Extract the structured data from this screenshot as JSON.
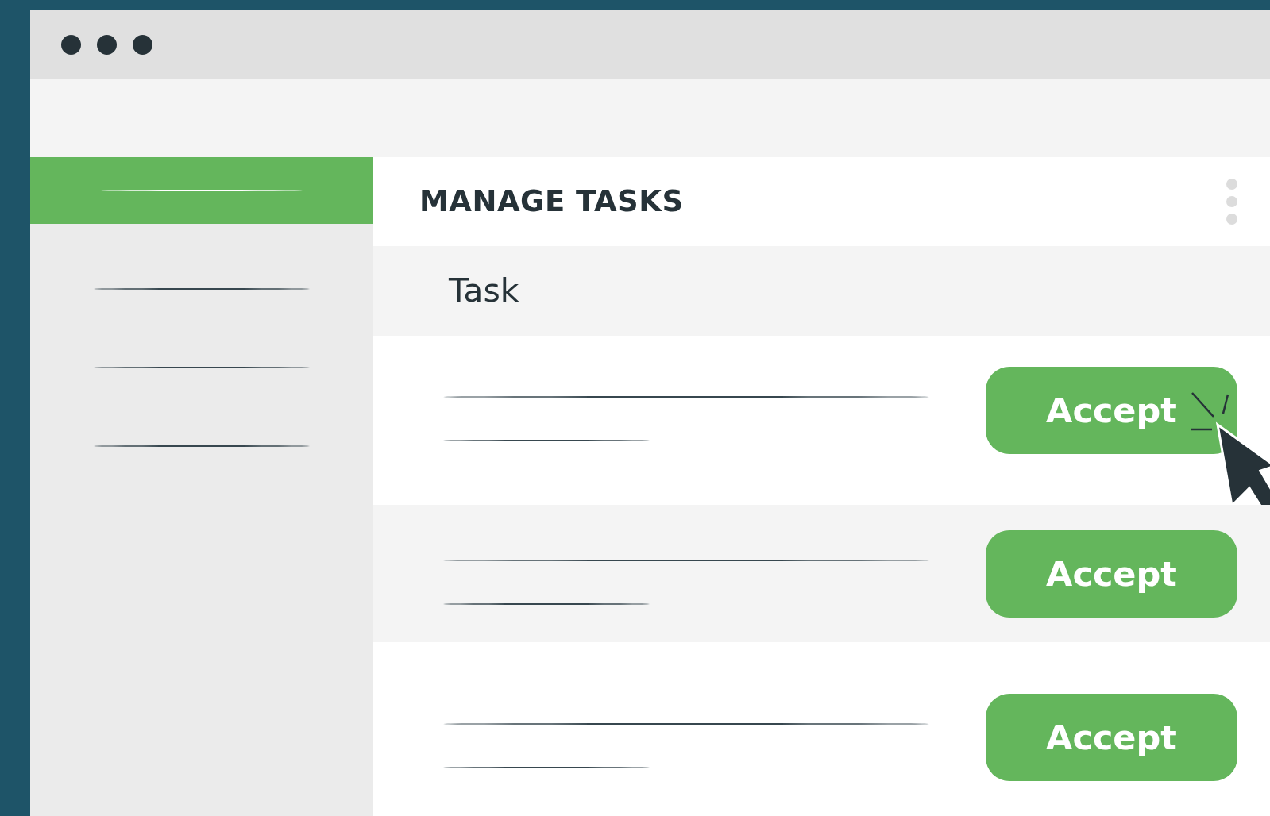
{
  "sidebar": {
    "items": [
      {
        "selected": true
      },
      {
        "selected": false
      },
      {
        "selected": false
      },
      {
        "selected": false
      }
    ]
  },
  "panel": {
    "title": "MANAGE TASKS"
  },
  "table": {
    "columns": [
      "Task"
    ],
    "rows": [
      {
        "action": "Accept",
        "pointer": true
      },
      {
        "action": "Accept",
        "pointer": false
      },
      {
        "action": "Accept",
        "pointer": false
      }
    ]
  }
}
